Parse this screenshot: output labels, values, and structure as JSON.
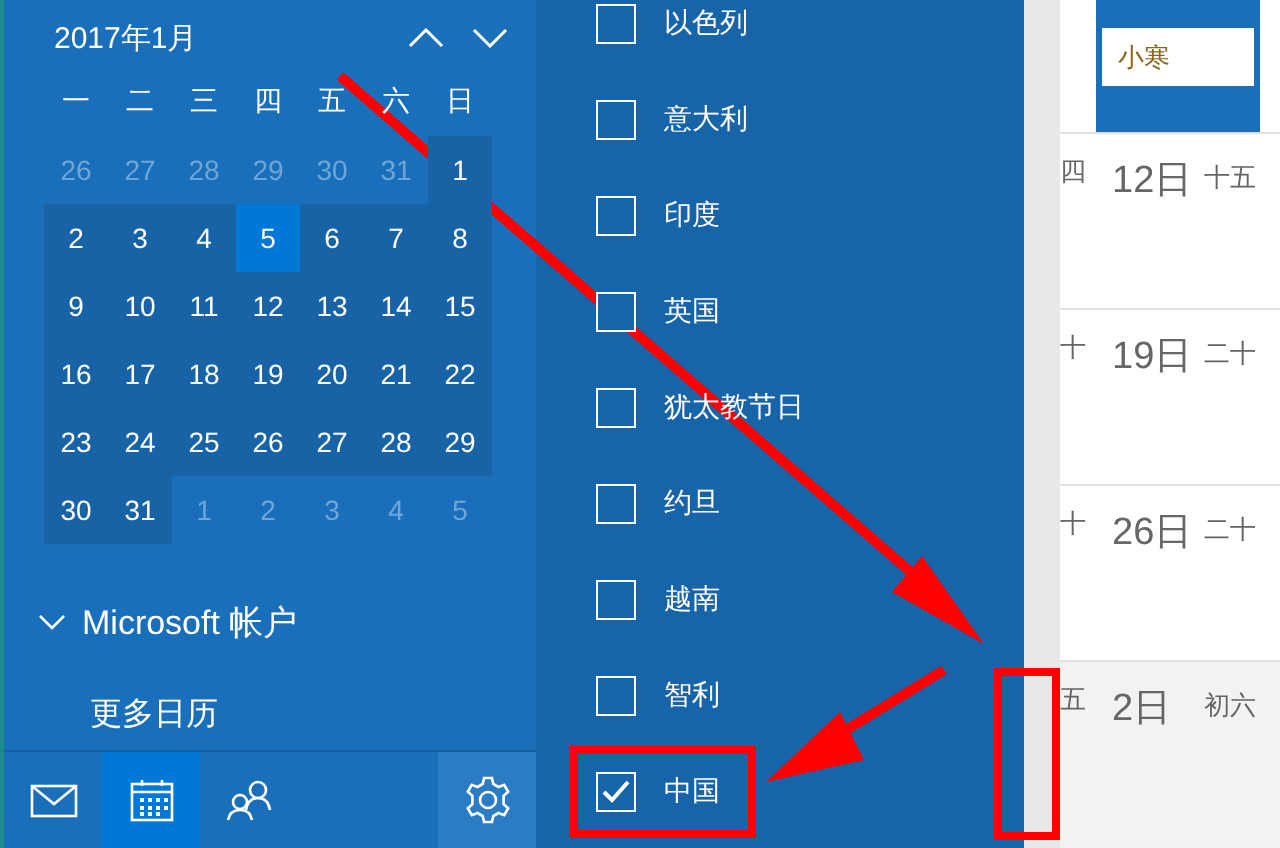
{
  "calendar": {
    "title": "2017年1月",
    "weekdays": [
      "一",
      "二",
      "三",
      "四",
      "五",
      "六",
      "日"
    ],
    "weeks": [
      [
        {
          "day": "26",
          "in_month": false,
          "selected": false
        },
        {
          "day": "27",
          "in_month": false,
          "selected": false
        },
        {
          "day": "28",
          "in_month": false,
          "selected": false
        },
        {
          "day": "29",
          "in_month": false,
          "selected": false
        },
        {
          "day": "30",
          "in_month": false,
          "selected": false
        },
        {
          "day": "31",
          "in_month": false,
          "selected": false
        },
        {
          "day": "1",
          "in_month": true,
          "selected": false
        }
      ],
      [
        {
          "day": "2",
          "in_month": true,
          "selected": false
        },
        {
          "day": "3",
          "in_month": true,
          "selected": false
        },
        {
          "day": "4",
          "in_month": true,
          "selected": false
        },
        {
          "day": "5",
          "in_month": true,
          "selected": true
        },
        {
          "day": "6",
          "in_month": true,
          "selected": false
        },
        {
          "day": "7",
          "in_month": true,
          "selected": false
        },
        {
          "day": "8",
          "in_month": true,
          "selected": false
        }
      ],
      [
        {
          "day": "9",
          "in_month": true,
          "selected": false
        },
        {
          "day": "10",
          "in_month": true,
          "selected": false
        },
        {
          "day": "11",
          "in_month": true,
          "selected": false
        },
        {
          "day": "12",
          "in_month": true,
          "selected": false
        },
        {
          "day": "13",
          "in_month": true,
          "selected": false
        },
        {
          "day": "14",
          "in_month": true,
          "selected": false
        },
        {
          "day": "15",
          "in_month": true,
          "selected": false
        }
      ],
      [
        {
          "day": "16",
          "in_month": true,
          "selected": false
        },
        {
          "day": "17",
          "in_month": true,
          "selected": false
        },
        {
          "day": "18",
          "in_month": true,
          "selected": false
        },
        {
          "day": "19",
          "in_month": true,
          "selected": false
        },
        {
          "day": "20",
          "in_month": true,
          "selected": false
        },
        {
          "day": "21",
          "in_month": true,
          "selected": false
        },
        {
          "day": "22",
          "in_month": true,
          "selected": false
        }
      ],
      [
        {
          "day": "23",
          "in_month": true,
          "selected": false
        },
        {
          "day": "24",
          "in_month": true,
          "selected": false
        },
        {
          "day": "25",
          "in_month": true,
          "selected": false
        },
        {
          "day": "26",
          "in_month": true,
          "selected": false
        },
        {
          "day": "27",
          "in_month": true,
          "selected": false
        },
        {
          "day": "28",
          "in_month": true,
          "selected": false
        },
        {
          "day": "29",
          "in_month": true,
          "selected": false
        }
      ],
      [
        {
          "day": "30",
          "in_month": true,
          "selected": false
        },
        {
          "day": "31",
          "in_month": true,
          "selected": false
        },
        {
          "day": "1",
          "in_month": false,
          "selected": false
        },
        {
          "day": "2",
          "in_month": false,
          "selected": false
        },
        {
          "day": "3",
          "in_month": false,
          "selected": false
        },
        {
          "day": "4",
          "in_month": false,
          "selected": false
        },
        {
          "day": "5",
          "in_month": false,
          "selected": false
        }
      ]
    ]
  },
  "account": {
    "label": "Microsoft 帐户",
    "expanded": true
  },
  "more_calendars": "更多日历",
  "nav": [
    {
      "kind": "mail",
      "selected": false
    },
    {
      "kind": "calendar",
      "selected": true
    },
    {
      "kind": "people",
      "selected": false
    }
  ],
  "holidays": [
    {
      "label": "以色列",
      "checked": false
    },
    {
      "label": "意大利",
      "checked": false
    },
    {
      "label": "印度",
      "checked": false
    },
    {
      "label": "英国",
      "checked": false
    },
    {
      "label": "犹太教节日",
      "checked": false
    },
    {
      "label": "约旦",
      "checked": false
    },
    {
      "label": "越南",
      "checked": false
    },
    {
      "label": "智利",
      "checked": false
    },
    {
      "label": "中国",
      "checked": true
    }
  ],
  "selected_day": {
    "note": "小寒"
  },
  "week_rows": [
    {
      "lunar_left": "四",
      "date": "12日",
      "lunar_right": "十五",
      "other_month": false
    },
    {
      "lunar_left": "十",
      "date": "19日",
      "lunar_right": "二十",
      "other_month": false
    },
    {
      "lunar_left": "十",
      "date": "26日",
      "lunar_right": "二十",
      "other_month": false
    },
    {
      "lunar_left": "五",
      "date": "2日",
      "lunar_right": "初六",
      "other_month": true
    }
  ]
}
